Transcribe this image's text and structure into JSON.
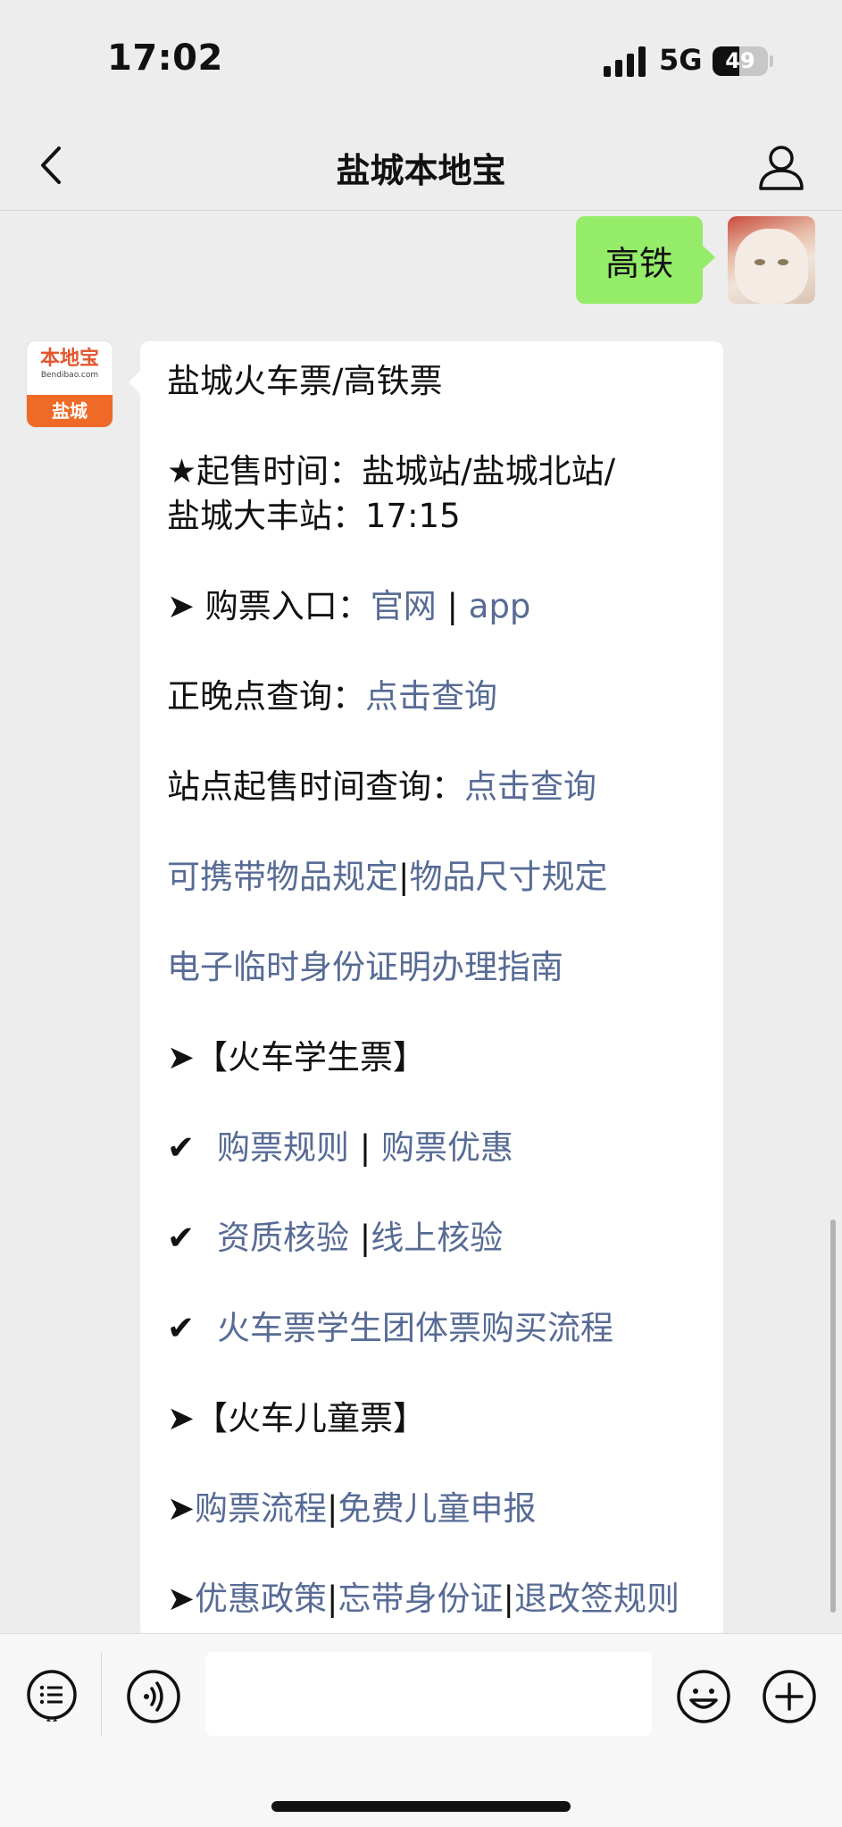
{
  "status": {
    "time": "17:02",
    "network": "5G",
    "battery": "49",
    "battery_level": 0.49
  },
  "nav": {
    "title": "盐城本地宝",
    "back_icon": "chevron-left-icon",
    "profile_icon": "person-icon"
  },
  "outgoing": {
    "text": "高铁"
  },
  "bot_avatar": {
    "brand": "本地宝",
    "domain": "Bendibao.com",
    "city": "盐城"
  },
  "reply": {
    "title": "盐城火车票/高铁票",
    "sale_time_1": "★起售时间：盐城站/盐城北站/",
    "sale_time_2": "盐城大丰站：17:15",
    "buy_entry_label": "➤ 购票入口：",
    "buy_entry_link1": "官网",
    "buy_entry_sep": " | ",
    "buy_entry_link2": "app",
    "punctuality_label": "正晚点查询：",
    "punctuality_link": "点击查询",
    "station_time_label": "站点起售时间查询：",
    "station_time_link": "点击查询",
    "items_link1": "可携带物品规定",
    "items_sep": "|",
    "items_link2": "物品尺寸规定",
    "eid_link": "电子临时身份证明办理指南",
    "student_header": "➤【火车学生票】",
    "check_mark": "✔",
    "student_rule": "购票规则",
    "student_sep1": " | ",
    "student_discount": "购票优惠",
    "qual_check": "资质核验",
    "student_sep2": " |",
    "online_check": "线上核验",
    "group_flow": "火车票学生团体票购买流程",
    "child_header": "➤【火车儿童票】",
    "arrow": "➤",
    "child_flow": "购票流程",
    "child_sep": "|",
    "child_free": "免费儿童申报",
    "policy": "优惠政策",
    "forgot_id": "忘带身份证",
    "refund": "退改签规则"
  },
  "inputbar": {
    "menu_icon": "list-menu-icon",
    "voice_icon": "voice-icon",
    "emoji_icon": "emoji-icon",
    "plus_icon": "plus-icon"
  }
}
